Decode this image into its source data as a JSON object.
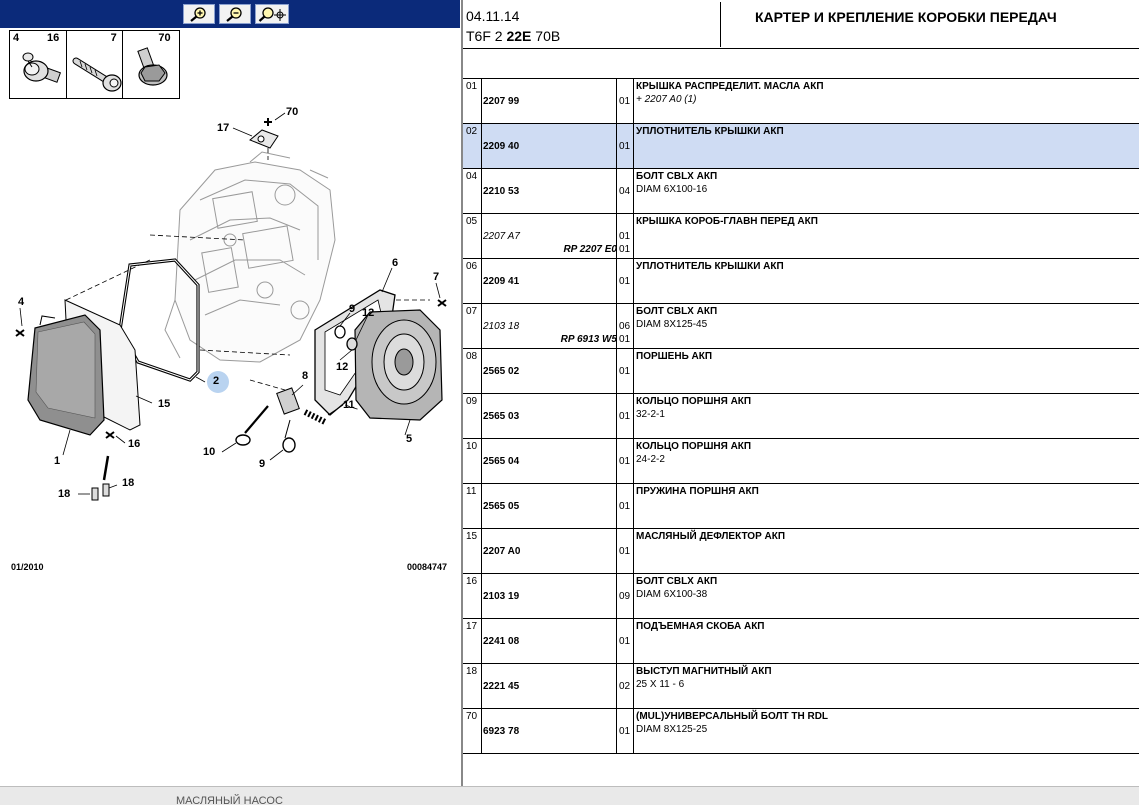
{
  "header": {
    "date": "04.11.14",
    "model_prefix": "T6F 2",
    "model_bold": "22E",
    "model_suffix": "70B",
    "title": "КАРТЕР И КРЕПЛЕНИЕ КОРОБКИ ПЕРЕДАЧ"
  },
  "toolbar": {
    "zoom_in_icon": "zoom-in-icon",
    "zoom_out_icon": "zoom-out-icon",
    "zoom_fit_icon": "zoom-pan-icon"
  },
  "legend": [
    {
      "num": "4"
    },
    {
      "num": "16"
    },
    {
      "num": "7"
    },
    {
      "num": "70"
    }
  ],
  "diagram": {
    "labels": {
      "l17": "17",
      "l70": "70",
      "l4": "4",
      "l2": "2",
      "l15": "15",
      "l16": "16",
      "l1": "1",
      "l18a": "18",
      "l18b": "18",
      "l6": "6",
      "l7": "7",
      "l9a": "9",
      "l12a": "12",
      "l12b": "12",
      "l8": "8",
      "l11": "11",
      "l10": "10",
      "l9b": "9",
      "l5": "5"
    },
    "footer_date": "01/2010",
    "footer_code": "00084747"
  },
  "parts": [
    {
      "idx": "01",
      "ref": "2207 99",
      "ref_italic": false,
      "rp": "",
      "qty": "01",
      "qty2": "",
      "desc": "КРЫШКА РАСПРЕДЕЛИТ. МАСЛА АКП",
      "sub": "+ 2207 A0 (1)",
      "sub_italic": true,
      "selected": false
    },
    {
      "idx": "02",
      "ref": "2209 40",
      "ref_italic": false,
      "rp": "",
      "qty": "01",
      "qty2": "",
      "desc": "УПЛОТНИТЕЛЬ КРЫШКИ АКП",
      "sub": "",
      "sub_italic": false,
      "selected": true
    },
    {
      "idx": "04",
      "ref": "2210 53",
      "ref_italic": false,
      "rp": "",
      "qty": "04",
      "qty2": "",
      "desc": "БОЛТ CBLX АКП",
      "sub": "DIAM 6X100-16",
      "sub_italic": false,
      "selected": false
    },
    {
      "idx": "05",
      "ref": "2207 A7",
      "ref_italic": true,
      "rp": "RP 2207 E0",
      "qty": "01",
      "qty2": "01",
      "desc": "КРЫШКА КОРОБ-ГЛАВН ПЕРЕД АКП",
      "sub": "",
      "sub_italic": false,
      "selected": false
    },
    {
      "idx": "06",
      "ref": "2209 41",
      "ref_italic": false,
      "rp": "",
      "qty": "01",
      "qty2": "",
      "desc": "УПЛОТНИТЕЛЬ КРЫШКИ АКП",
      "sub": "",
      "sub_italic": false,
      "selected": false
    },
    {
      "idx": "07",
      "ref": "2103 18",
      "ref_italic": true,
      "rp": "RP 6913 W5",
      "qty": "06",
      "qty2": "01",
      "desc": "БОЛТ CBLX АКП",
      "sub": "DIAM 8X125-45",
      "sub_italic": false,
      "selected": false
    },
    {
      "idx": "08",
      "ref": "2565 02",
      "ref_italic": false,
      "rp": "",
      "qty": "01",
      "qty2": "",
      "desc": "ПОРШЕНЬ АКП",
      "sub": "",
      "sub_italic": false,
      "selected": false
    },
    {
      "idx": "09",
      "ref": "2565 03",
      "ref_italic": false,
      "rp": "",
      "qty": "01",
      "qty2": "",
      "desc": "КОЛЬЦО ПОРШНЯ АКП",
      "sub": "32-2-1",
      "sub_italic": false,
      "selected": false
    },
    {
      "idx": "10",
      "ref": "2565 04",
      "ref_italic": false,
      "rp": "",
      "qty": "01",
      "qty2": "",
      "desc": "КОЛЬЦО ПОРШНЯ АКП",
      "sub": "24-2-2",
      "sub_italic": false,
      "selected": false
    },
    {
      "idx": "11",
      "ref": "2565 05",
      "ref_italic": false,
      "rp": "",
      "qty": "01",
      "qty2": "",
      "desc": "ПРУЖИНА ПОРШНЯ АКП",
      "sub": "",
      "sub_italic": false,
      "selected": false
    },
    {
      "idx": "15",
      "ref": "2207 A0",
      "ref_italic": false,
      "rp": "",
      "qty": "01",
      "qty2": "",
      "desc": "МАСЛЯНЫЙ ДЕФЛЕКТОР АКП",
      "sub": "",
      "sub_italic": false,
      "selected": false
    },
    {
      "idx": "16",
      "ref": "2103 19",
      "ref_italic": false,
      "rp": "",
      "qty": "09",
      "qty2": "",
      "desc": "БОЛТ CBLX АКП",
      "sub": "DIAM 6X100-38",
      "sub_italic": false,
      "selected": false
    },
    {
      "idx": "17",
      "ref": "2241 08",
      "ref_italic": false,
      "rp": "",
      "qty": "01",
      "qty2": "",
      "desc": "ПОДЪЕМНАЯ СКОБА АКП",
      "sub": "",
      "sub_italic": false,
      "selected": false
    },
    {
      "idx": "18",
      "ref": "2221 45",
      "ref_italic": false,
      "rp": "",
      "qty": "02",
      "qty2": "",
      "desc": "ВЫСТУП МАГНИТНЫЙ АКП",
      "sub": "25 X 11 - 6",
      "sub_italic": false,
      "selected": false
    },
    {
      "idx": "70",
      "ref": "6923 78",
      "ref_italic": false,
      "rp": "",
      "qty": "01",
      "qty2": "",
      "desc": "(MUL)УНИВЕРСАЛЬНЫЙ БОЛТ TH RDL",
      "sub": "DIAM 8X125-25",
      "sub_italic": false,
      "selected": false
    }
  ],
  "bottom": {
    "text": "МАСЛЯНЫЙ НАСОС"
  },
  "colors": {
    "toolbar_bg": "#0b2a7a",
    "selected_row": "#cfdcf3",
    "callout_highlight": "#b9d3f0"
  }
}
